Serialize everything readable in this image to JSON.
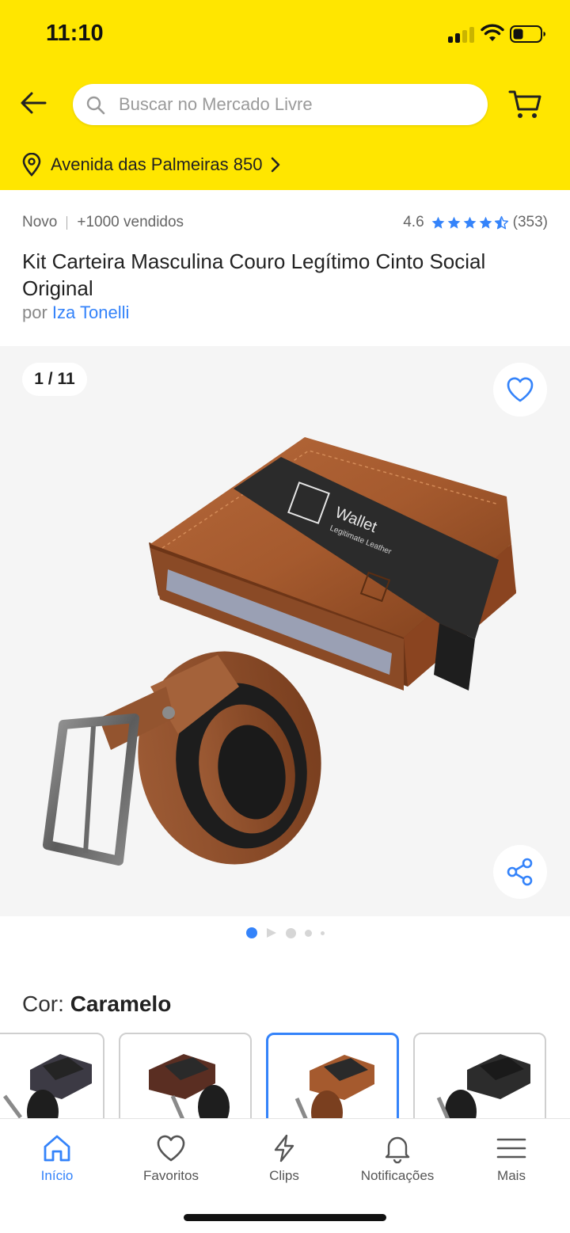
{
  "status_bar": {
    "time": "11:10"
  },
  "header": {
    "search_placeholder": "Buscar no Mercado Livre",
    "address": "Avenida das Palmeiras 850",
    "brand_color": "#FFE600"
  },
  "product": {
    "condition": "Novo",
    "sold": "+1000 vendidos",
    "rating": "4.6",
    "rating_stars": 4.5,
    "reviews": "(353)",
    "title": "Kit Carteira Masculina Couro Legítimo Cinto Social Original",
    "seller_prefix": "por",
    "seller_name": "Iza Tonelli"
  },
  "gallery": {
    "counter": "1 / 11",
    "active_index": 0,
    "wallet_band_brand": "Wallet",
    "wallet_band_tagline": "Legitimate Leather"
  },
  "color": {
    "label": "Cor:",
    "value": "Caramelo",
    "selected_index": 2
  },
  "bottom_nav": [
    {
      "label": "Início",
      "icon": "home-icon",
      "active": true
    },
    {
      "label": "Favoritos",
      "icon": "heart-icon",
      "active": false
    },
    {
      "label": "Clips",
      "icon": "lightning-icon",
      "active": false
    },
    {
      "label": "Notificações",
      "icon": "bell-icon",
      "active": false
    },
    {
      "label": "Mais",
      "icon": "menu-icon",
      "active": false
    }
  ],
  "colors": {
    "accent": "#3483FA",
    "header": "#FFE600",
    "star": "#3483FA"
  }
}
